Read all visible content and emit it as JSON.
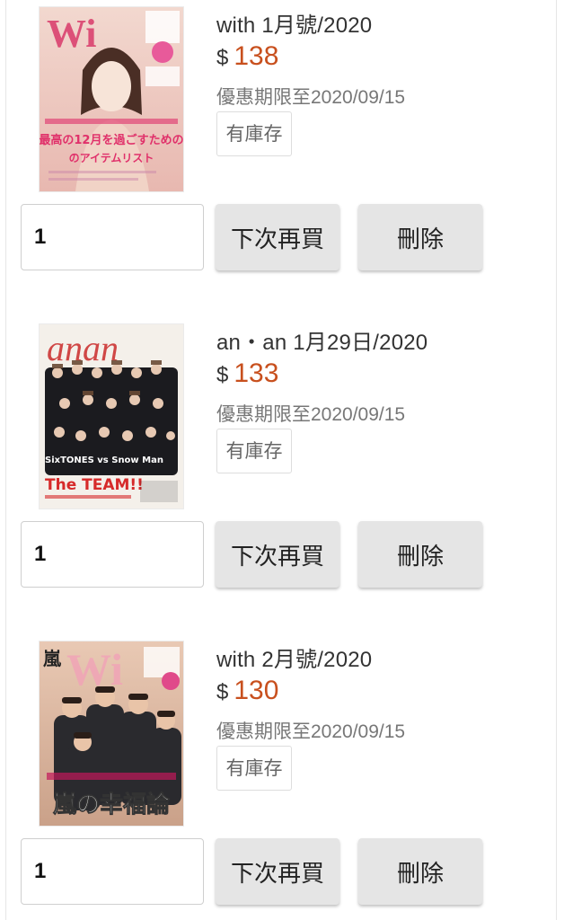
{
  "items": [
    {
      "title": "with 1月號/2020",
      "currency": "$",
      "price": "138",
      "promo": "優惠期限至2020/09/15",
      "stock": "有庫存",
      "quantity": "1",
      "buy_later_label": "下次再買",
      "delete_label": "刪除",
      "cover_headline": "最高の12月を過ごすための",
      "cover_subline": "のアイテムリスト",
      "cover_accent": "#e0306a"
    },
    {
      "title": "an・an 1月29日/2020",
      "currency": "$",
      "price": "133",
      "promo": "優惠期限至2020/09/15",
      "stock": "有庫存",
      "quantity": "1",
      "buy_later_label": "下次再買",
      "delete_label": "刪除",
      "cover_headline": "The TEAM!!",
      "cover_subline": "SixTONES vs Snow Man",
      "cover_accent": "#d62a2a"
    },
    {
      "title": "with 2月號/2020",
      "currency": "$",
      "price": "130",
      "promo": "優惠期限至2020/09/15",
      "stock": "有庫存",
      "quantity": "1",
      "buy_later_label": "下次再買",
      "delete_label": "刪除",
      "cover_headline": "嵐の幸福論",
      "cover_subline": "嵐",
      "cover_accent": "#c2185b"
    }
  ],
  "colors": {
    "price": "#c8501e",
    "button_bg": "#e5e5e5",
    "text": "#333333",
    "muted": "#777777"
  }
}
